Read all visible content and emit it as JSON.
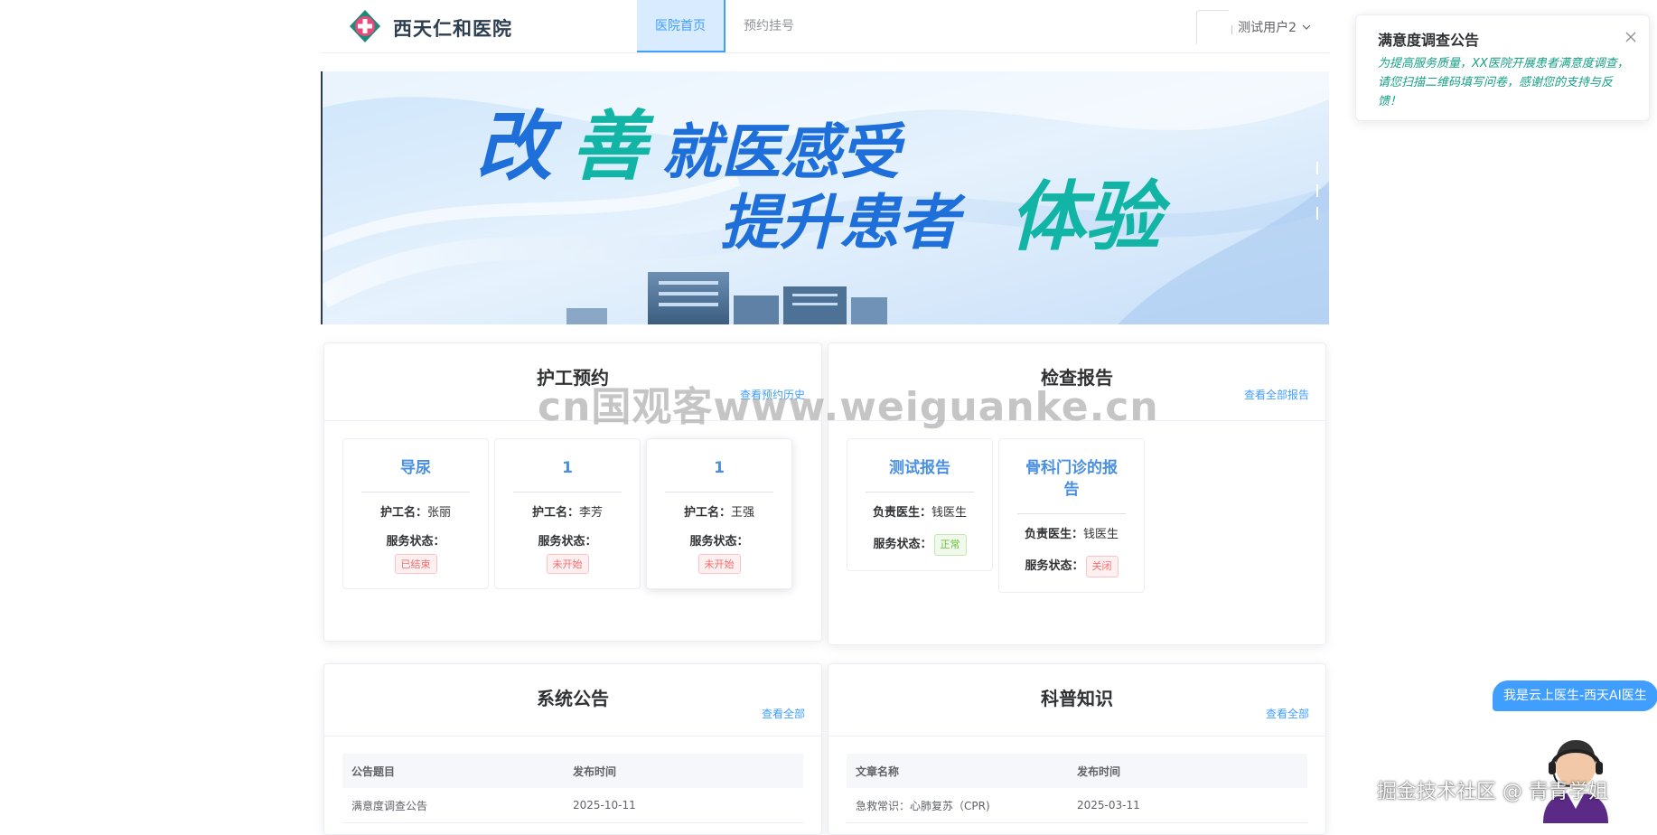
{
  "header": {
    "brand": "西天仁和医院",
    "nav": [
      {
        "label": "医院首页",
        "active": true
      },
      {
        "label": "预约挂号",
        "active": false
      }
    ],
    "username": "测试用户2"
  },
  "banner": {
    "line1_a": "改",
    "line1_b": "善",
    "line1_c": "就医感受",
    "line2_a": "提升患者",
    "line2_b": "体验"
  },
  "nursing": {
    "title": "护工预约",
    "link": "查看预约历史",
    "nurse_label": "护工名：",
    "status_label": "服务状态：",
    "items": [
      {
        "title": "导尿",
        "nurse": "张丽",
        "status": "已结束"
      },
      {
        "title": "1",
        "nurse": "李芳",
        "status": "未开始"
      },
      {
        "title": "1",
        "nurse": "王强",
        "status": "未开始"
      }
    ]
  },
  "reports": {
    "title": "检查报告",
    "link": "查看全部报告",
    "doctor_label": "负责医生：",
    "status_label": "服务状态：",
    "items": [
      {
        "title": "测试报告",
        "doctor": "钱医生",
        "status": "正常"
      },
      {
        "title": "骨科门诊的报告",
        "doctor": "钱医生",
        "status": "关闭"
      }
    ]
  },
  "announcements": {
    "title": "系统公告",
    "link": "查看全部",
    "col1": "公告题目",
    "col2": "发布时间",
    "rows": [
      {
        "name": "满意度调查公告",
        "date": "2025-10-11"
      }
    ]
  },
  "science": {
    "title": "科普知识",
    "link": "查看全部",
    "col1": "文章名称",
    "col2": "发布时间",
    "rows": [
      {
        "name": "急救常识：心肺复苏（CPR)",
        "date": "2025-03-11"
      }
    ]
  },
  "notice": {
    "title": "满意度调查公告",
    "body": "为提高服务质量，XX医院开展患者满意度调查，请您扫描二维码填写问卷，感谢您的支持与反馈！"
  },
  "ai": {
    "bubble": "我是云上医生-西天AI医生"
  },
  "watermarks": {
    "center": "cn国观客www.weiguanke.cn",
    "corner": "掘金技术社区 @ 青青学姐"
  },
  "colors": {
    "accent": "#409eff",
    "banner_blue": "#1e6fd9",
    "banner_teal": "#12b5a5",
    "notice_text": "#16a085"
  }
}
